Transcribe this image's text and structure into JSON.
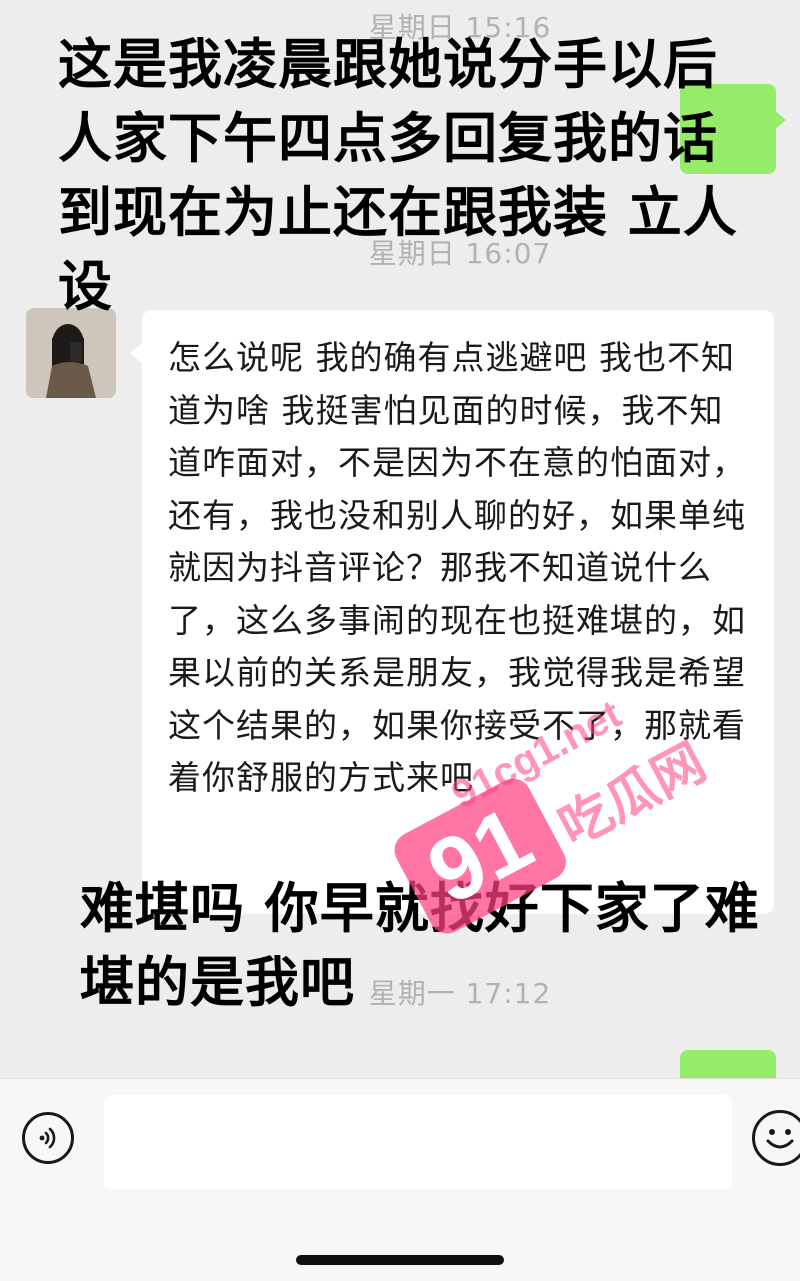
{
  "timestamps": [
    "星期日 15:16",
    "星期日 16:07",
    "星期一 17:12"
  ],
  "caption_top": "这是我凌晨跟她说分手以后人家下午四点多回复我的话 到现在为止还在跟我装 立人设",
  "incoming_message": "怎么说呢 我的确有点逃避吧 我也不知道为啥 我挺害怕见面的时候，我不知道咋面对，不是因为不在意的怕面对，还有，我也没和别人聊的好，如果单纯就因为抖音评论？那我不知道说什么了，这么多事闹的现在也挺难堪的，如果以前的关系是朋友，我觉得我是希望这个结果的，如果你接受不了，那就看着你舒服的方式来吧",
  "caption_bottom": "难堪吗 你早就找好下家了难堪的是我吧",
  "watermark": {
    "badge": "91",
    "url": "91cg1.net",
    "name": "吃瓜网"
  },
  "input_bar": {
    "value": ""
  },
  "icons": {
    "voice": "voice-icon",
    "emoji": "emoji-icon"
  },
  "colors": {
    "sent_bubble": "#95ec69",
    "background": "#ededed",
    "watermark": "#ff4081"
  }
}
